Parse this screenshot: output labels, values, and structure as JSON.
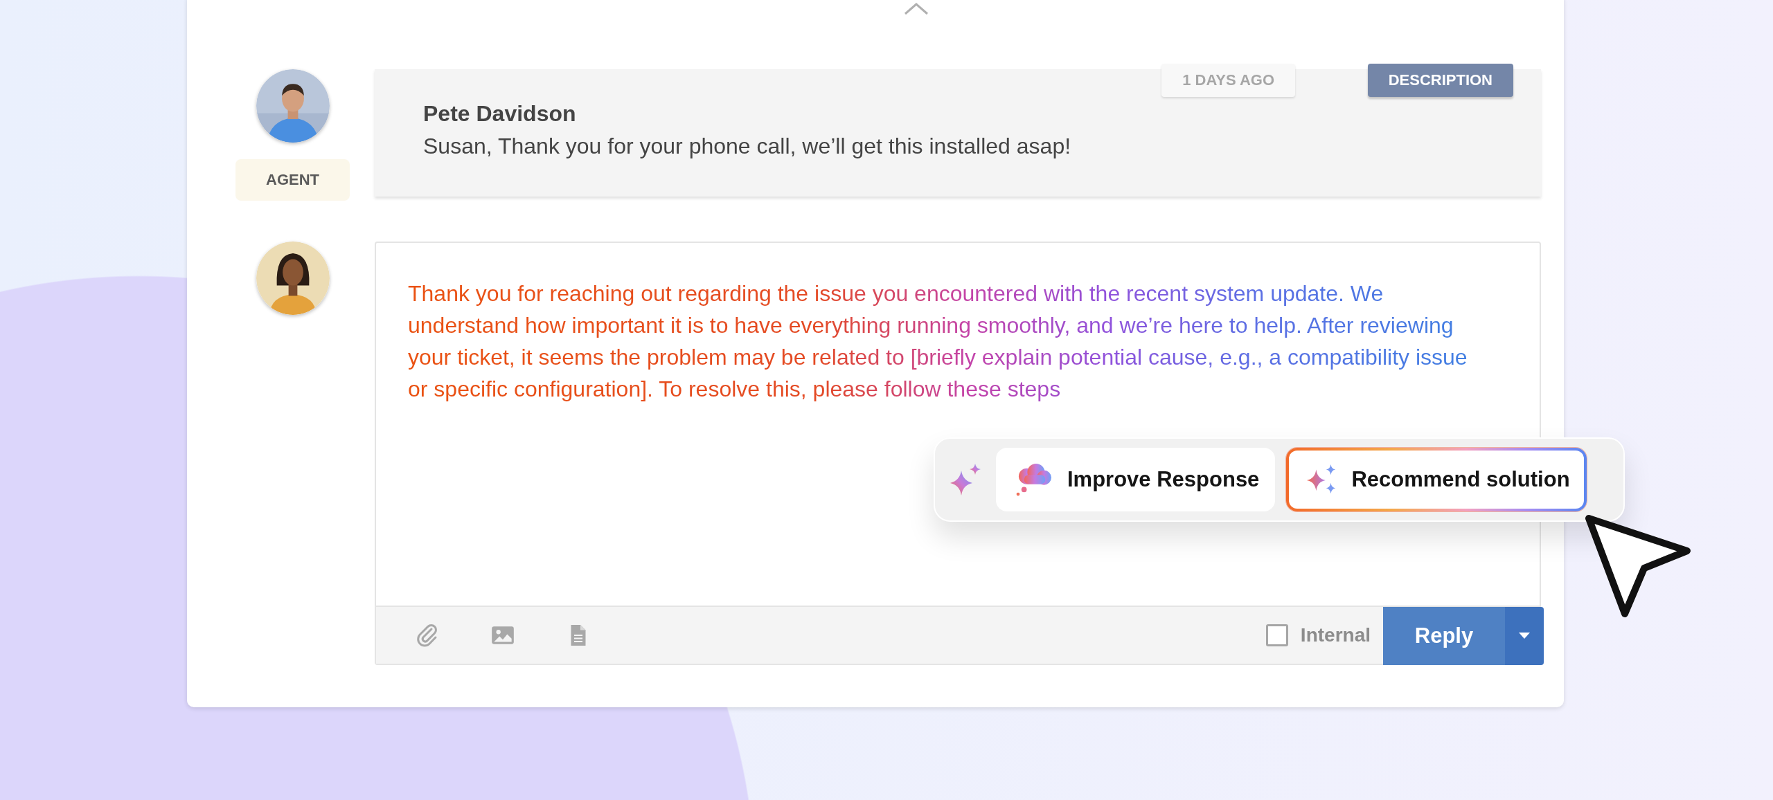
{
  "messages": [
    {
      "author": "Pete Davidson",
      "role": "AGENT",
      "text": "Susan, Thank you for your phone call, we’ll get this installed asap!",
      "age": "1 DAYS AGO",
      "tag": "DESCRIPTION"
    }
  ],
  "reply": {
    "text": "Thank you for reaching out regarding the issue you encountered with the recent system update. We understand how important it is to have everything running smoothly, and we’re here to help. After reviewing your ticket, it seems the problem may be related to [briefly explain potential cause, e.g., a compatibility issue or specific configuration]. To resolve this, please follow these steps",
    "internal": {
      "label": "Internal",
      "checked": false
    },
    "send": "Reply"
  },
  "ai_actions": [
    {
      "kind": "improve",
      "label": "Improve Response",
      "selected": false
    },
    {
      "kind": "recommend",
      "label": "Recommend solution",
      "selected": true
    }
  ]
}
